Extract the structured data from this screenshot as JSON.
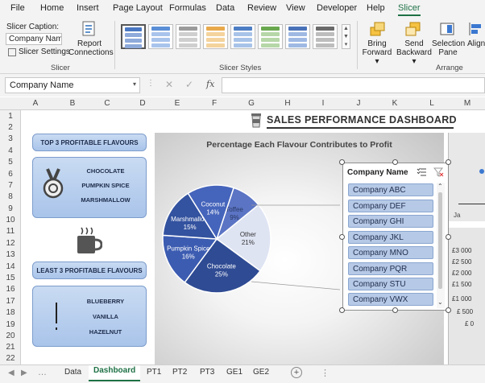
{
  "menu": [
    "File",
    "Home",
    "Insert",
    "Page Layout",
    "Formulas",
    "Data",
    "Review",
    "View",
    "Developer",
    "Help",
    "Slicer"
  ],
  "ribbon": {
    "slicer_caption_label": "Slicer Caption:",
    "slicer_caption_value": "Company Name",
    "slicer_settings": "Slicer Settings",
    "report_connections_1": "Report",
    "report_connections_2": "Connections",
    "group_slicer": "Slicer",
    "group_styles": "Slicer Styles",
    "bring_forward_1": "Bring",
    "bring_forward_2": "Forward",
    "send_backward_1": "Send",
    "send_backward_2": "Backward",
    "selection_pane_1": "Selection",
    "selection_pane_2": "Pane",
    "align": "Align",
    "group_arrange": "Arrange"
  },
  "formula_bar": {
    "name_box": "Company Name",
    "fx": "fx"
  },
  "columns": [
    "A",
    "B",
    "C",
    "D",
    "E",
    "F",
    "G",
    "H",
    "I",
    "J",
    "K",
    "L",
    "M"
  ],
  "rows": [
    "1",
    "2",
    "3",
    "4",
    "5",
    "6",
    "7",
    "8",
    "9",
    "10",
    "11",
    "12",
    "13",
    "14",
    "15",
    "16",
    "17",
    "18",
    "19",
    "20",
    "21",
    "22"
  ],
  "dashboard": {
    "title": "SALES PERFORMANCE DASHBOARD",
    "top3_title": "TOP 3 PROFITABLE FLAVOURS",
    "top3": [
      "CHOCOLATE",
      "PUMPKIN SPICE",
      "MARSHMALLOW"
    ],
    "least3_title": "LEAST 3 PROFITABLE FLAVOURS",
    "least3": [
      "BLUEBERRY",
      "VANILLA",
      "HAZELNUT"
    ],
    "right_partial_label": "Ja",
    "right_axis": [
      "£3 000",
      "£2 500",
      "£2 000",
      "£1 500",
      "£1 000",
      "£ 500",
      "£ 0"
    ]
  },
  "chart_data": {
    "type": "pie",
    "title": "Percentage Each Flavour Contributes to Profit",
    "slices": [
      {
        "label": "Toffee",
        "value": 9,
        "color": "#5b74c4"
      },
      {
        "label": "Other",
        "value": 21,
        "color": "#dfe4f3"
      },
      {
        "label": "Chocolate",
        "value": 25,
        "color": "#2f4b93"
      },
      {
        "label": "Pumpkin Spice",
        "value": 16,
        "color": "#3c5cb1"
      },
      {
        "label": "Marshmallow",
        "value": 15,
        "color": "#33529f"
      },
      {
        "label": "Coconut",
        "value": 14,
        "color": "#4564bb"
      }
    ]
  },
  "slicer": {
    "title": "Company Name",
    "items": [
      "Company ABC",
      "Company DEF",
      "Company GHI",
      "Company JKL",
      "Company MNO",
      "Company PQR",
      "Company STU",
      "Company VWX"
    ]
  },
  "sheet_tabs": [
    "Data",
    "Dashboard",
    "PT1",
    "PT2",
    "PT3",
    "GE1",
    "GE2"
  ],
  "colors": {
    "accent": "#1e7145",
    "box_fill": "#b6cdee",
    "pie_dark": "#2f4b93"
  }
}
